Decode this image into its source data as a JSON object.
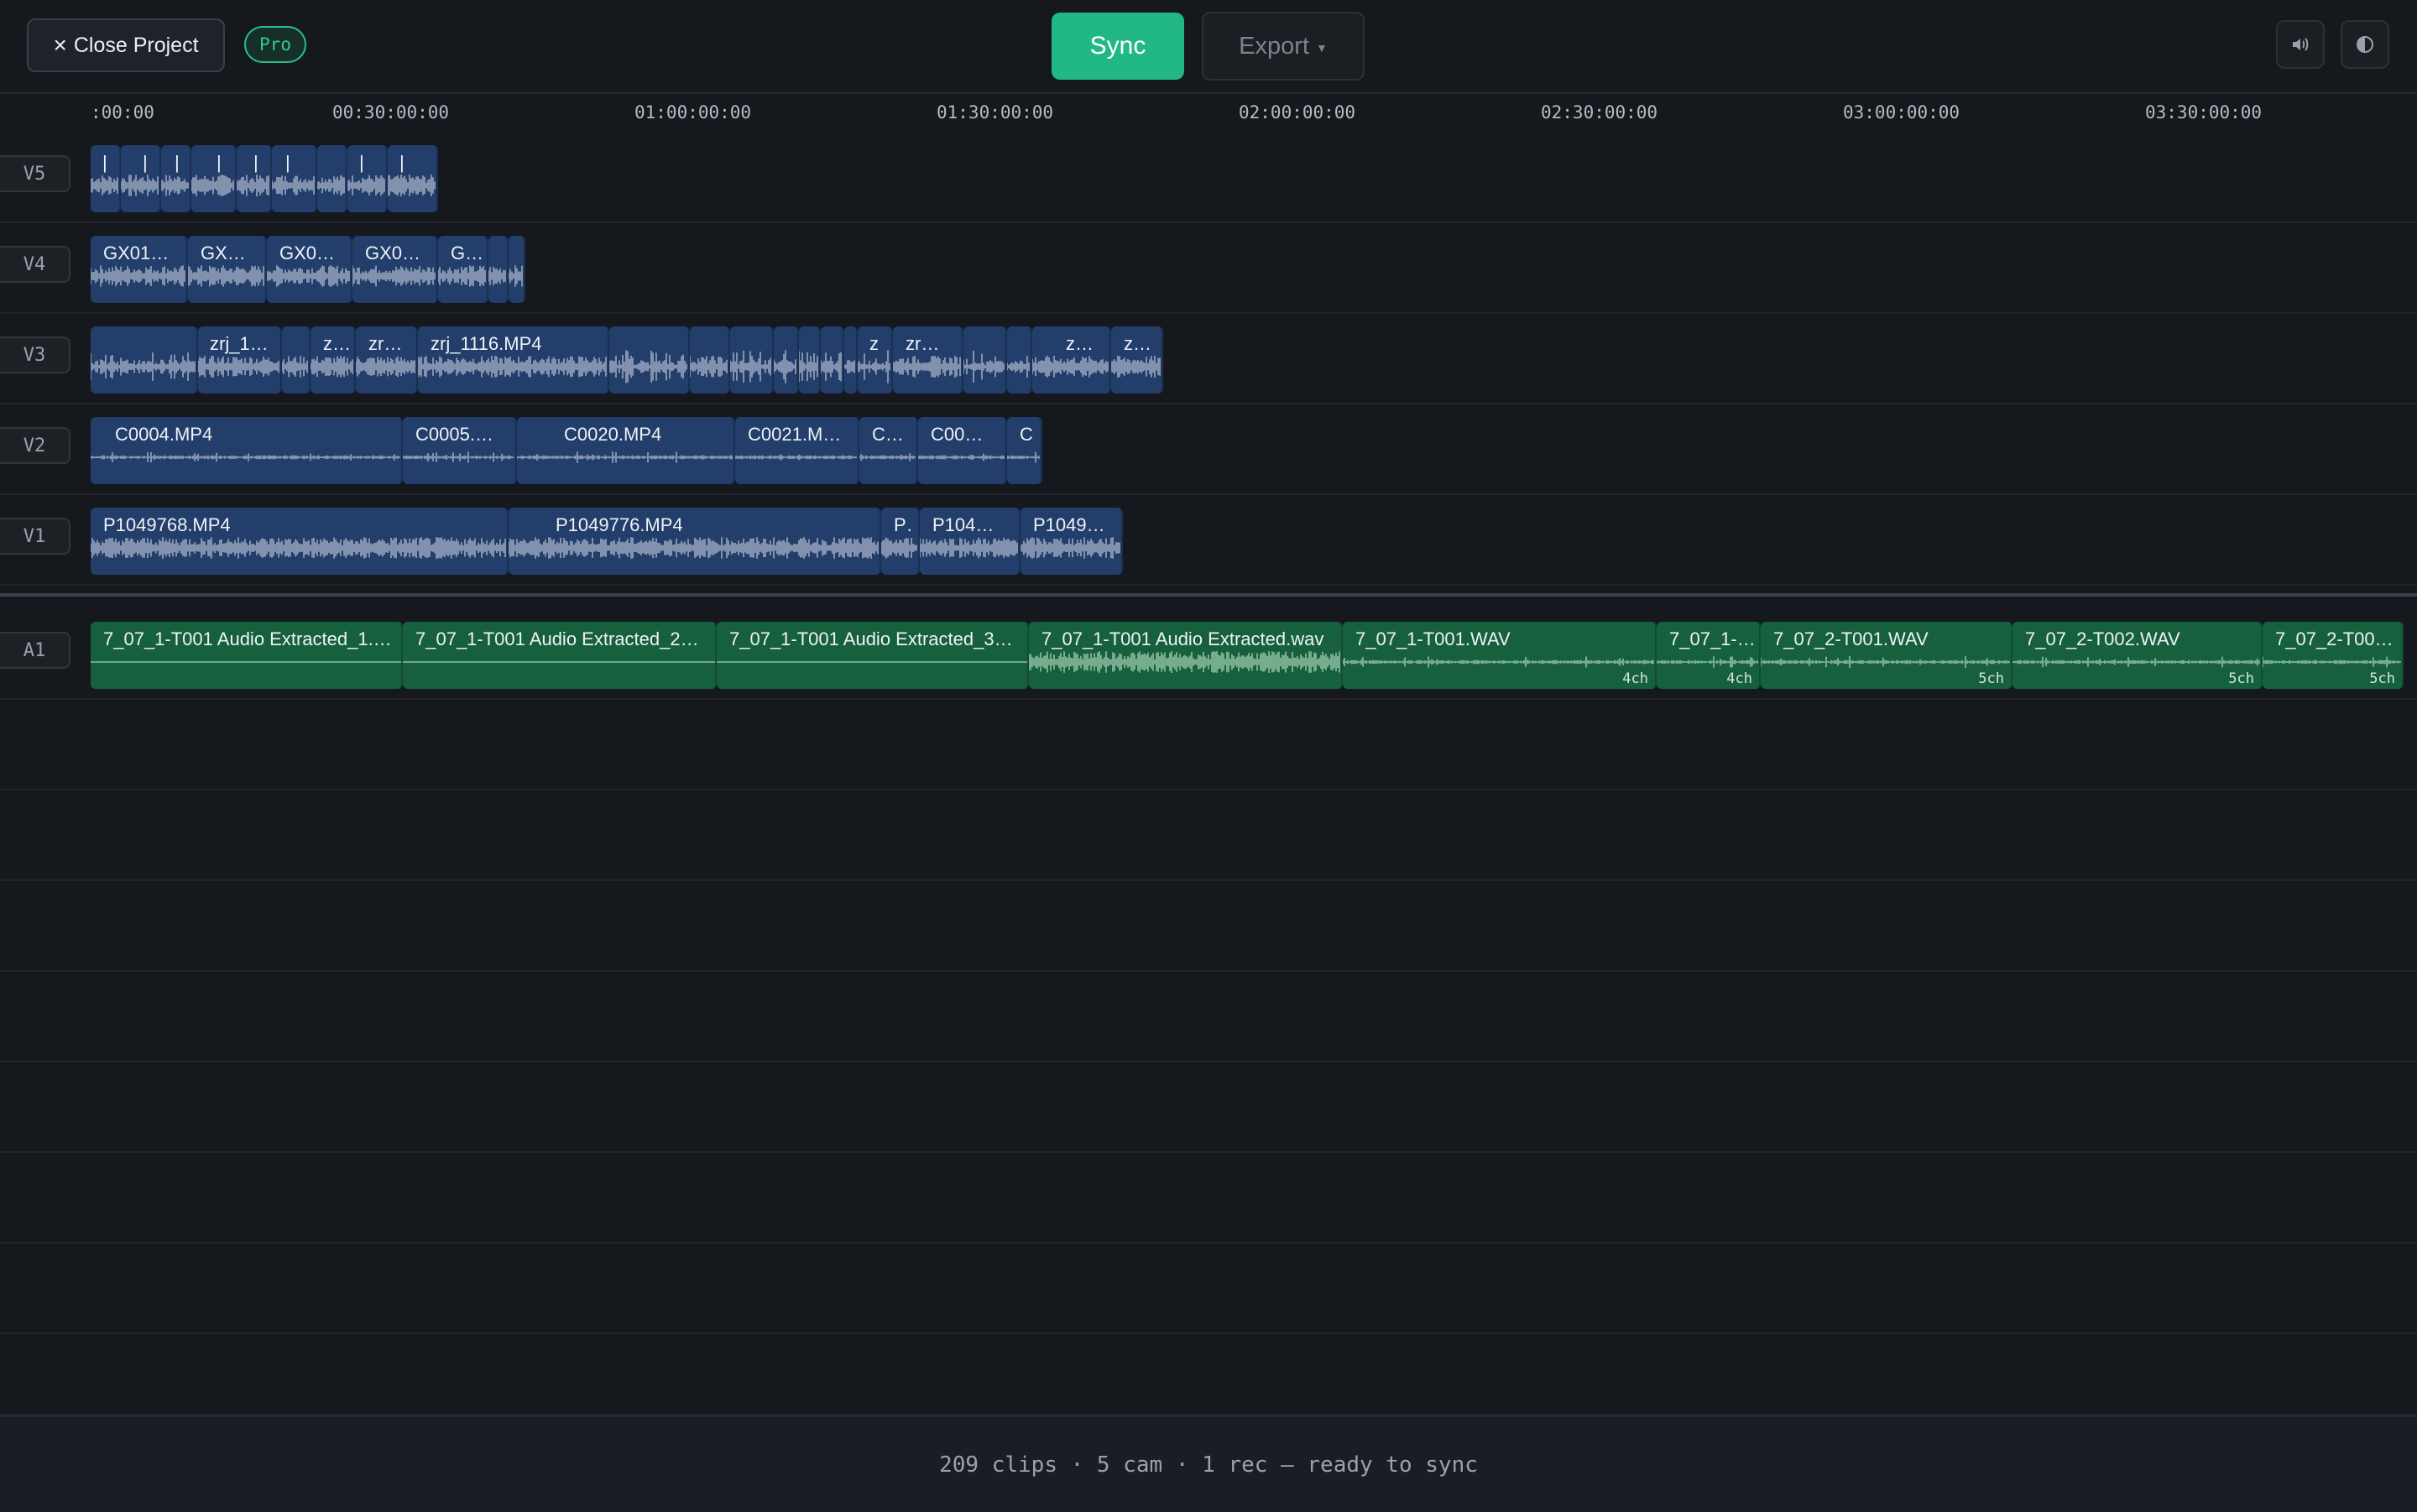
{
  "header": {
    "close_label": "Close Project",
    "pro_badge": "Pro",
    "sync_label": "Sync",
    "export_label": "Export"
  },
  "ruler": {
    "ticks": [
      ":00:00",
      "00:30:00:00",
      "01:00:00:00",
      "01:30:00:00",
      "02:00:00:00",
      "02:30:00:00",
      "03:00:00:00",
      "03:30:00:00"
    ]
  },
  "tracks": {
    "v5": {
      "label": "V5"
    },
    "v4": {
      "label": "V4",
      "clips": [
        "GX01…",
        "GX…",
        "GX0…",
        "GX0…",
        "G…"
      ]
    },
    "v3": {
      "label": "V3",
      "clips": [
        "zrj_1…",
        "z…",
        "zr…",
        "zrj_1116.MP4",
        "z",
        "zr…",
        "z…",
        "z…"
      ]
    },
    "v2": {
      "label": "V2",
      "clips": [
        "C0004.MP4",
        "C0005.…",
        "C0020.MP4",
        "C0021.M…",
        "C…",
        "C00…",
        "C"
      ]
    },
    "v1": {
      "label": "V1",
      "clips": [
        "P1049768.MP4",
        "P1049776.MP4",
        "P…",
        "P104…",
        "P1049…"
      ]
    },
    "a1": {
      "label": "A1",
      "clips": [
        {
          "name": "7_07_1-T001 Audio Extracted_1.…",
          "ch": ""
        },
        {
          "name": "7_07_1-T001 Audio Extracted_2…",
          "ch": ""
        },
        {
          "name": "7_07_1-T001 Audio Extracted_3…",
          "ch": ""
        },
        {
          "name": "7_07_1-T001 Audio Extracted.wav",
          "ch": ""
        },
        {
          "name": "7_07_1-T001.WAV",
          "ch": "4ch"
        },
        {
          "name": "7_07_1-…",
          "ch": "4ch"
        },
        {
          "name": "7_07_2-T001.WAV",
          "ch": "5ch"
        },
        {
          "name": "7_07_2-T002.WAV",
          "ch": "5ch"
        },
        {
          "name": "7_07_2-T00…",
          "ch": "5ch"
        }
      ]
    }
  },
  "status": {
    "text": "209 clips · 5 cam · 1 rec — ready to sync"
  },
  "colors": {
    "accent": "#22b886",
    "video_clip": "#233e6a",
    "audio_clip": "#17603e",
    "background": "#15181d"
  },
  "icons": [
    "close-icon",
    "volume-icon",
    "contrast-icon",
    "dropdown-caret-icon"
  ]
}
